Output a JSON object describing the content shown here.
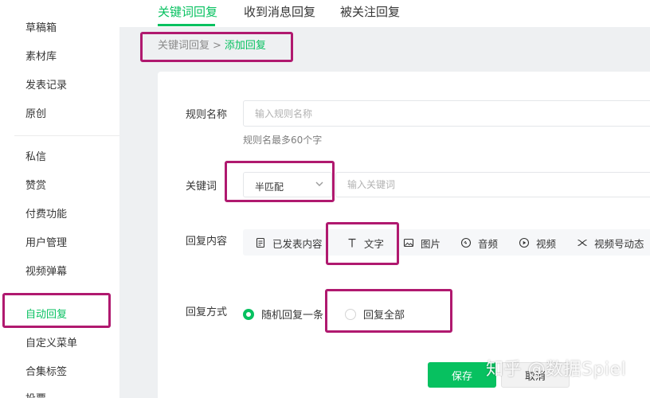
{
  "sidebar": {
    "items": [
      {
        "label": "草稿箱"
      },
      {
        "label": "素材库"
      },
      {
        "label": "发表记录"
      },
      {
        "label": "原创"
      },
      {
        "label": "私信"
      },
      {
        "label": "赞赏"
      },
      {
        "label": "付费功能"
      },
      {
        "label": "用户管理"
      },
      {
        "label": "视频弹幕"
      },
      {
        "label": "自动回复"
      },
      {
        "label": "自定义菜单"
      },
      {
        "label": "合集标签"
      },
      {
        "label": "投票"
      }
    ],
    "active_index": 9
  },
  "tabs": [
    {
      "label": "关键词回复",
      "active": true
    },
    {
      "label": "收到消息回复",
      "active": false
    },
    {
      "label": "被关注回复",
      "active": false
    }
  ],
  "breadcrumb": {
    "parent": "关键词回复",
    "separator": ">",
    "current": "添加回复"
  },
  "form": {
    "rule_name": {
      "label": "规则名称",
      "placeholder": "输入规则名称",
      "value": "",
      "hint": "规则名最多60个字"
    },
    "keyword": {
      "label": "关键词",
      "match_mode": "半匹配",
      "placeholder": "输入关键词",
      "value": ""
    },
    "reply_content": {
      "label": "回复内容",
      "types": [
        {
          "label": "已发表内容",
          "icon": "document-icon"
        },
        {
          "label": "文字",
          "icon": "text-icon"
        },
        {
          "label": "图片",
          "icon": "image-icon"
        },
        {
          "label": "音频",
          "icon": "audio-icon"
        },
        {
          "label": "视频",
          "icon": "video-icon"
        },
        {
          "label": "视频号动态",
          "icon": "channels-icon"
        }
      ]
    },
    "reply_mode": {
      "label": "回复方式",
      "options": [
        {
          "label": "随机回复一条",
          "checked": true
        },
        {
          "label": "回复全部",
          "checked": false
        }
      ]
    }
  },
  "buttons": {
    "save": "保存",
    "cancel": "取消"
  },
  "watermark": "知乎 @数据Spiel",
  "colors": {
    "accent": "#07c160",
    "highlight": "#b0196f"
  }
}
